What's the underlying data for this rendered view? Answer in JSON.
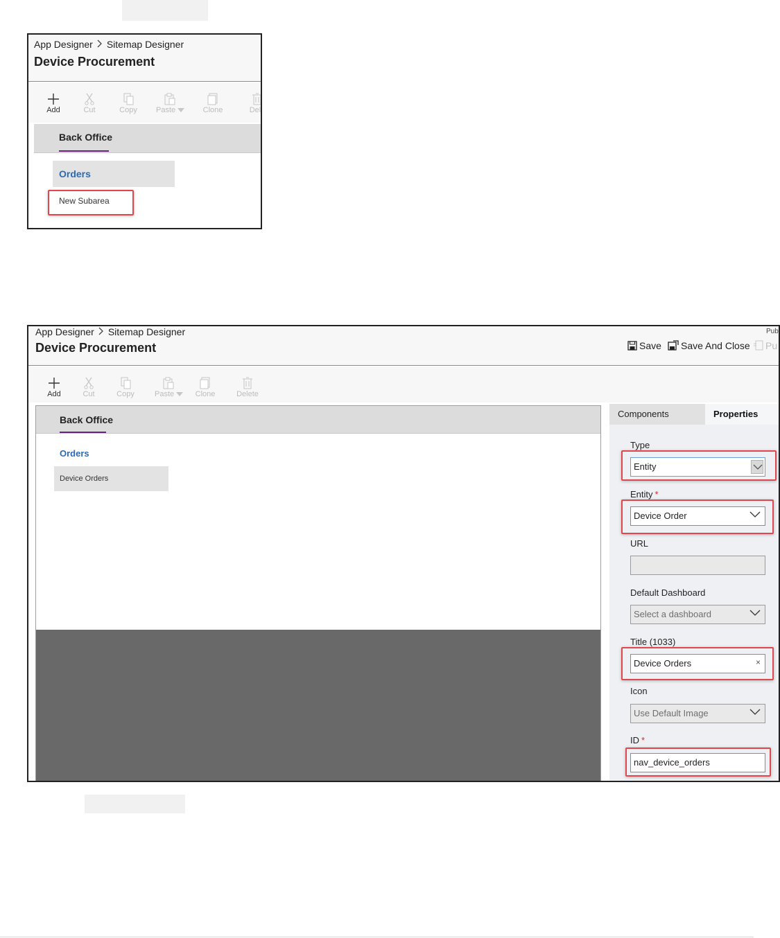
{
  "screens": [
    {
      "breadcrumb": {
        "first": "App Designer",
        "second": "Sitemap Designer"
      },
      "page_title": "Device Procurement",
      "commands": [
        {
          "label": "Add",
          "icon": "plus-icon",
          "enabled": true
        },
        {
          "label": "Cut",
          "icon": "scissors-icon",
          "enabled": false
        },
        {
          "label": "Copy",
          "icon": "copy-icon",
          "enabled": false
        },
        {
          "label": "Paste",
          "icon": "paste-icon",
          "enabled": false
        },
        {
          "label": "Clone",
          "icon": "clone-icon",
          "enabled": false
        },
        {
          "label": "Dele",
          "icon": "delete-icon",
          "enabled": false
        }
      ],
      "area_tab": "Back Office",
      "group": "Orders",
      "subarea": "New Subarea"
    },
    {
      "breadcrumb": {
        "first": "App Designer",
        "second": "Sitemap Designer"
      },
      "page_title": "Device Procurement",
      "top_actions": {
        "save": "Save",
        "save_and_close": "Save And Close",
        "publish_partial": "Pu",
        "publish_top": "Pub"
      },
      "commands": [
        {
          "label": "Add",
          "icon": "plus-icon",
          "enabled": true
        },
        {
          "label": "Cut",
          "icon": "scissors-icon",
          "enabled": false
        },
        {
          "label": "Copy",
          "icon": "copy-icon",
          "enabled": false
        },
        {
          "label": "Paste",
          "icon": "paste-icon",
          "enabled": false
        },
        {
          "label": "Clone",
          "icon": "clone-icon",
          "enabled": false
        },
        {
          "label": "Delete",
          "icon": "delete-icon",
          "enabled": false
        }
      ],
      "area_tab": "Back Office",
      "group": "Orders",
      "subarea": "Device Orders",
      "panel": {
        "tabs": {
          "components": "Components",
          "properties": "Properties"
        },
        "type": {
          "label": "Type",
          "value": "Entity"
        },
        "entity": {
          "label": "Entity",
          "required": "*",
          "value": "Device Order"
        },
        "url": {
          "label": "URL",
          "value": ""
        },
        "default_dashboard": {
          "label": "Default Dashboard",
          "placeholder": "Select a dashboard"
        },
        "title": {
          "label": "Title (1033)",
          "value": "Device Orders",
          "clear": "×"
        },
        "icon": {
          "label": "Icon",
          "value": "Use Default Image"
        },
        "id": {
          "label": "ID",
          "required": "*",
          "value": "nav_device_orders"
        }
      }
    }
  ],
  "colors": {
    "highlight": "#e0474c",
    "accent_tab_underline": "#68217a",
    "group_text": "#2b6bb6",
    "required": "#e0242a"
  }
}
